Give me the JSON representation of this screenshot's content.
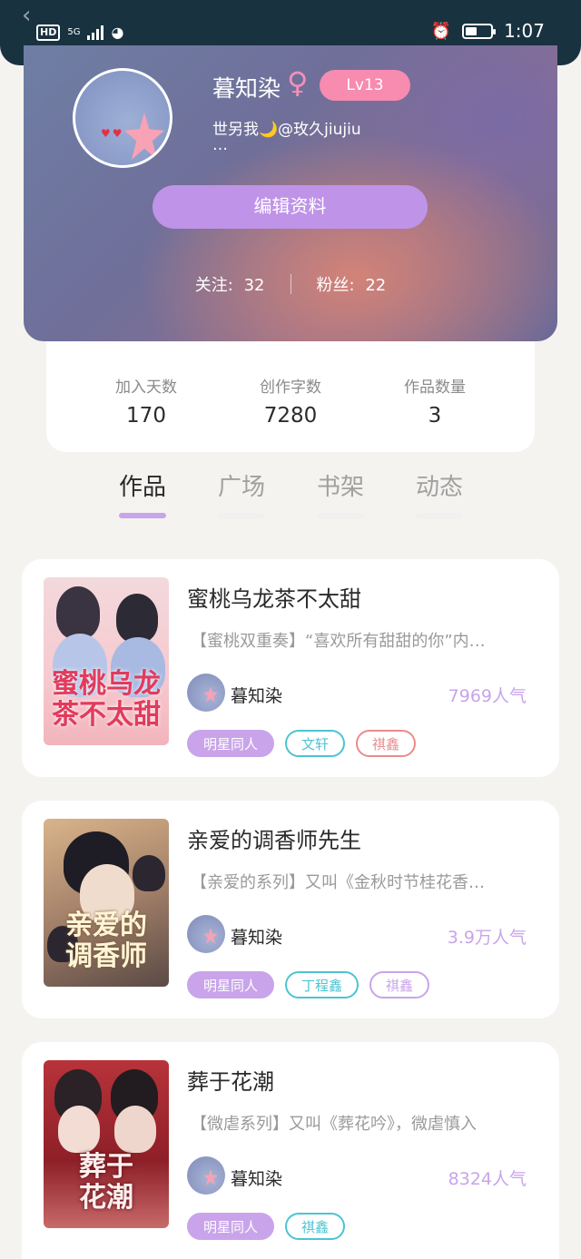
{
  "status_bar": {
    "hd": "HD",
    "network": "5G",
    "time": "1:07"
  },
  "profile": {
    "name": "暮知染",
    "gender_symbol": "♀",
    "level": "Lv13",
    "signature": "世另我🌙@玫久jiujiu",
    "signature_more": "…",
    "edit_button": "编辑资料",
    "following_label": "关注:",
    "following_count": "32",
    "fans_label": "粉丝:",
    "fans_count": "22"
  },
  "stats": [
    {
      "label": "加入天数",
      "value": "170"
    },
    {
      "label": "创作字数",
      "value": "7280"
    },
    {
      "label": "作品数量",
      "value": "3"
    }
  ],
  "tabs": [
    {
      "label": "作品",
      "active": true
    },
    {
      "label": "广场",
      "active": false
    },
    {
      "label": "书架",
      "active": false
    },
    {
      "label": "动态",
      "active": false
    }
  ],
  "works": [
    {
      "title": "蜜桃乌龙茶不太甜",
      "description": "【蜜桃双重奏】“喜欢所有甜甜的你”内…",
      "author": "暮知染",
      "popularity": "7969人气",
      "cover_text": "蜜桃乌龙\n茶不太甜",
      "tags": [
        {
          "label": "明星同人",
          "style": "fill",
          "color": "#c9a4ea"
        },
        {
          "label": "文轩",
          "style": "outline",
          "color": "#4cc4d2"
        },
        {
          "label": "祺鑫",
          "style": "outline",
          "color": "#e98c8c"
        }
      ]
    },
    {
      "title": "亲爱的调香师先生",
      "description": "【亲爱的系列】又叫《金秋时节桂花香…",
      "author": "暮知染",
      "popularity": "3.9万人气",
      "cover_text": "亲爱的\n调香师",
      "tags": [
        {
          "label": "明星同人",
          "style": "fill",
          "color": "#c9a4ea"
        },
        {
          "label": "丁程鑫",
          "style": "outline",
          "color": "#4cc4d2"
        },
        {
          "label": "祺鑫",
          "style": "outline",
          "color": "#c9a4ea"
        }
      ]
    },
    {
      "title": "葬于花潮",
      "description": "【微虐系列】又叫《葬花吟》，微虐慎入",
      "author": "暮知染",
      "popularity": "8324人气",
      "cover_text": "葬于\n花潮",
      "tags": [
        {
          "label": "明星同人",
          "style": "fill",
          "color": "#c9a4ea"
        },
        {
          "label": "祺鑫",
          "style": "outline",
          "color": "#4cc4d2"
        }
      ]
    }
  ],
  "colors": {
    "accent": "#c9a4ea",
    "edit_button": "#bf93e8",
    "level_badge": "#f78bb0"
  }
}
